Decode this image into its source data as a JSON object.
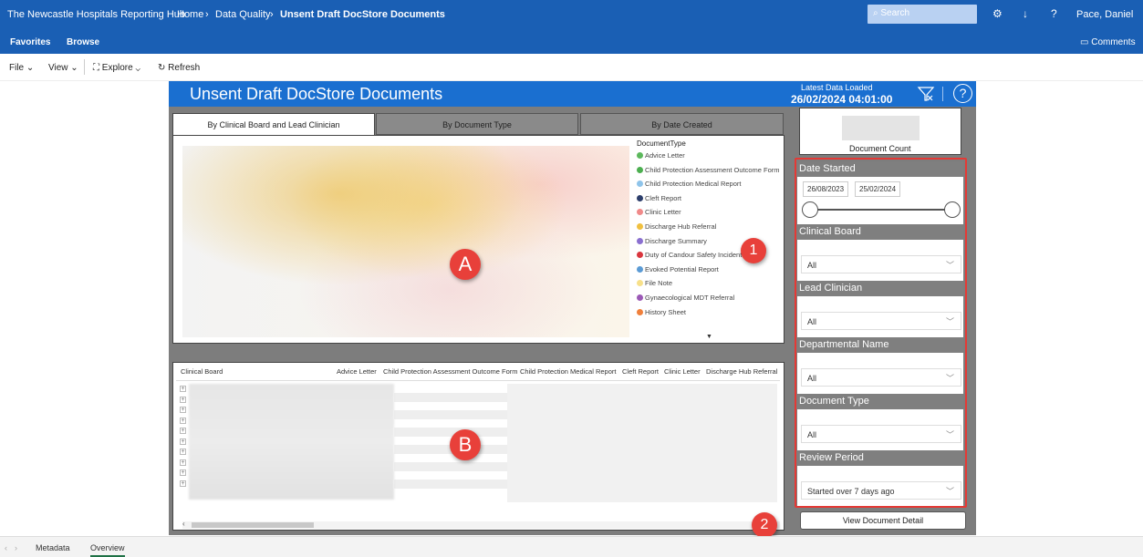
{
  "topbar": {
    "brand": "The Newcastle Hospitals Reporting Hub",
    "breadcrumb": [
      "Home",
      "Data Quality",
      "Unsent Draft DocStore Documents"
    ],
    "search_placeholder": "Search",
    "user": "Pace, Daniel"
  },
  "navbar": {
    "favorites": "Favorites",
    "browse": "Browse",
    "comments": "Comments"
  },
  "toolbar": {
    "file": "File",
    "view": "View",
    "explore": "Explore",
    "refresh": "Refresh"
  },
  "report": {
    "title": "Unsent Draft DocStore Documents",
    "latest_label": "Latest Data Loaded",
    "latest_value": "26/02/2024 04:01:00",
    "tabs": [
      "By Clinical Board and Lead Clinician",
      "By Document Type",
      "By Date Created"
    ],
    "legend_title": "DocumentType",
    "legend": [
      {
        "label": "Advice Letter",
        "color": "#5cb85c"
      },
      {
        "label": "Child Protection Assessment Outcome Form",
        "color": "#4caf50"
      },
      {
        "label": "Child Protection Medical Report",
        "color": "#8fc4ea"
      },
      {
        "label": "Cleft Report",
        "color": "#2c3e6b"
      },
      {
        "label": "Clinic Letter",
        "color": "#f08a8a"
      },
      {
        "label": "Discharge Hub Referral",
        "color": "#f0c040"
      },
      {
        "label": "Discharge Summary",
        "color": "#8a6fd0"
      },
      {
        "label": "Duty of Candour Safety Incident",
        "color": "#d9363e"
      },
      {
        "label": "Evoked Potential Report",
        "color": "#5b9bd5"
      },
      {
        "label": "File Note",
        "color": "#f7e08a"
      },
      {
        "label": "Gynaecological MDT Referral",
        "color": "#9b59b6"
      },
      {
        "label": "History Sheet",
        "color": "#f0803c"
      }
    ],
    "table_headers": [
      "Clinical Board",
      "Advice Letter",
      "Child Protection Assessment Outcome Form",
      "Child Protection Medical Report",
      "Cleft Report",
      "Clinic Letter",
      "Discharge Hub Referral"
    ],
    "doc_count_label": "Document Count",
    "slicers": {
      "date_started": {
        "title": "Date Started",
        "from": "26/08/2023",
        "to": "25/02/2024"
      },
      "clinical_board": {
        "title": "Clinical Board",
        "value": "All"
      },
      "lead_clinician": {
        "title": "Lead Clinician",
        "value": "All"
      },
      "departmental_name": {
        "title": "Departmental Name",
        "value": "All"
      },
      "document_type": {
        "title": "Document Type",
        "value": "All"
      },
      "review_period": {
        "title": "Review Period",
        "value": "Started over 7 days ago"
      }
    },
    "view_detail_button": "View Document Detail"
  },
  "badges": {
    "a": "A",
    "b": "B",
    "one": "1",
    "two": "2"
  },
  "bottom_tabs": [
    "Metadata",
    "Overview"
  ]
}
